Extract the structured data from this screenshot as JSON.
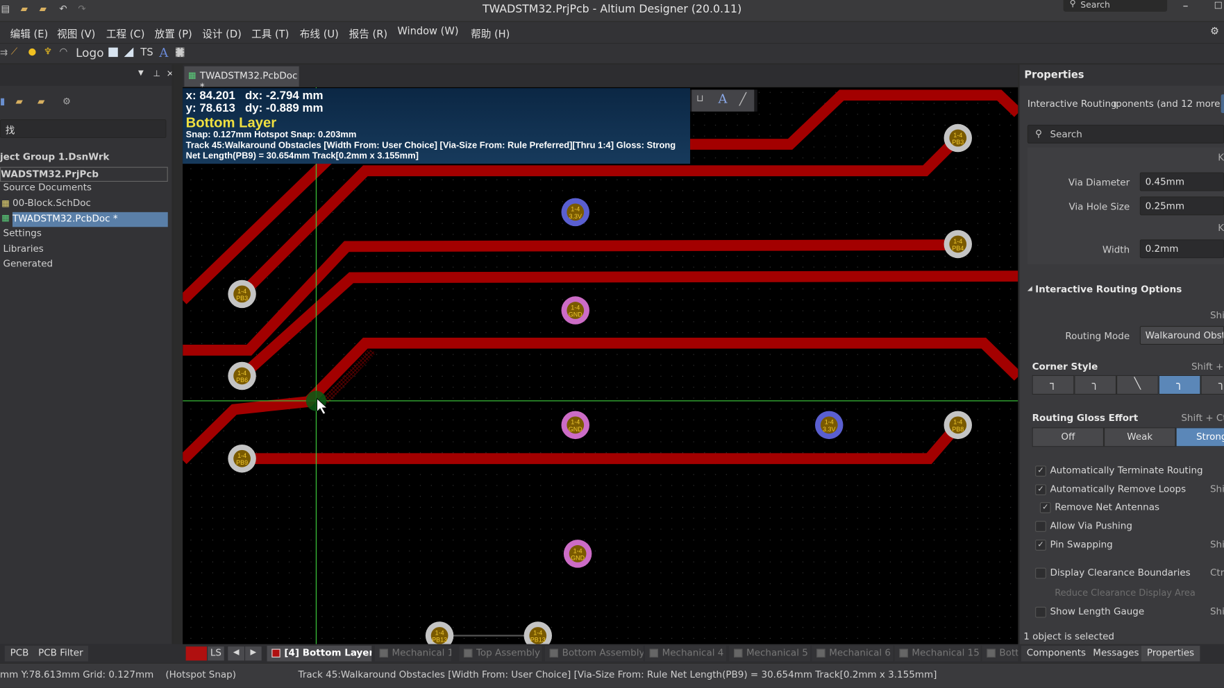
{
  "window": {
    "title": "TWADSTM32.PrjPcb - Altium Designer (20.0.11)",
    "search_placeholder": "Search"
  },
  "menu": [
    "编辑 (E)",
    "视图 (V)",
    "工程 (C)",
    "放置 (P)",
    "设计 (D)",
    "工具 (T)",
    "布线 (U)",
    "报告 (R)",
    "Window (W)",
    "帮助 (H)"
  ],
  "toolbar": {
    "logo": "Logo",
    "ts": "TS",
    "text_tool": "A"
  },
  "projects_panel": {
    "search_value": "找",
    "tree": [
      {
        "label": "ject Group 1.DsnWrk",
        "bold": true
      },
      {
        "label": "WADSTM32.PrjPcb",
        "bold": true
      },
      {
        "label": "Source Documents"
      },
      {
        "label": "00-Block.SchDoc"
      },
      {
        "label": "TWADSTM32.PcbDoc *",
        "selected": true
      },
      {
        "label": "Settings"
      },
      {
        "label": "Libraries"
      },
      {
        "label": "Generated"
      }
    ],
    "tabs": [
      "PCB",
      "PCB Filter"
    ]
  },
  "document_tab": "TWADSTM32.PcbDoc *",
  "heads_up": {
    "line1": "x: 84.201   dx: -2.794 mm",
    "line2": "y: 78.613   dy: -0.889 mm",
    "layer": "Bottom Layer",
    "snap": "Snap: 0.127mm Hotspot Snap: 0.203mm",
    "track": "Track 45:Walkaround Obstacles [Width From: User Choice] [Via-Size From: Rule Preferred][Thru 1:4] Gloss: Strong",
    "length": "Net Length(PB9) = 30.654mm Track[0.2mm x 3.155mm]"
  },
  "pads": [
    {
      "pin": "1-4",
      "net": "PB3",
      "kind": "signal"
    },
    {
      "pin": "1-4",
      "net": "3.3V",
      "kind": "power"
    },
    {
      "pin": "1-4",
      "net": "PB4",
      "kind": "signal"
    },
    {
      "pin": "1-4",
      "net": "PB3",
      "kind": "signal"
    },
    {
      "pin": "1-4",
      "net": "GND",
      "kind": "ground"
    },
    {
      "pin": "1-4",
      "net": "PB6",
      "kind": "signal"
    },
    {
      "pin": "1-4",
      "net": "GND",
      "kind": "ground"
    },
    {
      "pin": "1-4",
      "net": "3.3V",
      "kind": "power"
    },
    {
      "pin": "1-4",
      "net": "PB8",
      "kind": "signal"
    },
    {
      "pin": "1-4",
      "net": "PB9",
      "kind": "signal"
    },
    {
      "pin": "1-4",
      "net": "GND",
      "kind": "ground"
    },
    {
      "pin": "1-4",
      "net": "PB13",
      "kind": "signal"
    },
    {
      "pin": "1-4",
      "net": "PB13",
      "kind": "signal"
    }
  ],
  "colors": {
    "track": "#a30000",
    "signal_pad": "#c4c4c4",
    "power_pad": "#5a5fd0",
    "ground_pad": "#cc6cc6",
    "crosshair": "#3fd23f",
    "accent": "#5b87b8",
    "layer_bottom": "#b01010"
  },
  "properties": {
    "title": "Properties",
    "filter_label": "Interactive Routing",
    "filter_value": "ıponents (and 12 more)",
    "search_placeholder": "Search",
    "k1": "K",
    "k2": "K",
    "via_diameter_label": "Via Diameter",
    "via_diameter": "0.45mm",
    "via_hole_label": "Via Hole Size",
    "via_hole": "0.25mm",
    "width_label": "Width",
    "width": "0.2mm",
    "options_title": "Interactive Routing Options",
    "mode_shortcut": "Shi",
    "routing_mode_label": "Routing Mode",
    "routing_mode": "Walkaround Obsta",
    "corner_style_label": "Corner Style",
    "corner_shortcut": "Shift + ",
    "corner_styles": [
      "┐",
      "╮",
      "╲",
      "╮",
      "╮"
    ],
    "corner_selected": 3,
    "gloss_label": "Routing Gloss Effort",
    "gloss_shortcut": "Shift + Ct",
    "gloss_options": [
      "Off",
      "Weak",
      "Strong"
    ],
    "gloss_selected": 2,
    "checkboxes": [
      {
        "label": "Automatically Terminate Routing",
        "checked": true,
        "shortcut": ""
      },
      {
        "label": "Automatically Remove Loops",
        "checked": true,
        "shortcut": "Shif"
      },
      {
        "label": "Remove Net Antennas",
        "checked": true,
        "shortcut": "",
        "indent": true
      },
      {
        "label": "Allow Via Pushing",
        "checked": false,
        "shortcut": ""
      },
      {
        "label": "Pin Swapping",
        "checked": true,
        "shortcut": "Shi"
      },
      {
        "label": "Display Clearance Boundaries",
        "checked": false,
        "shortcut": "Ctr"
      },
      {
        "label": "Show Length Gauge",
        "checked": false,
        "shortcut": "Shi"
      }
    ],
    "reduce_clearance": "Reduce Clearance Display Area",
    "selection_status": "1 object is selected",
    "panel_tabs": [
      "Components",
      "Messages",
      "Properties"
    ]
  },
  "layer_bar": {
    "ls": "LS",
    "active": "[4] Bottom Layer",
    "layers": [
      "Mechanical 1",
      "Top Assembly",
      "Bottom Assembly",
      "Mechanical 4",
      "Mechanical 5",
      "Mechanical 6",
      "Mechanical 15",
      "Bott"
    ]
  },
  "status": {
    "position": "mm Y:78.613mm",
    "grid": "Grid: 0.127mm",
    "snap": "(Hotspot Snap)",
    "message": "Track 45:Walkaround Obstacles [Width From: User Choice] [Via-Size From: Rule  Net Length(PB9) = 30.654mm Track[0.2mm x 3.155mm]"
  }
}
